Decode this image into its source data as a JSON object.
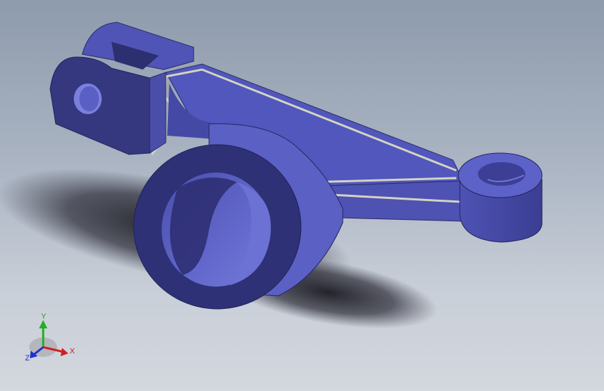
{
  "viewport": {
    "background_top": "#8e9bac",
    "background_bottom": "#d3d7de",
    "part_color": "#5a5fc0",
    "edge_color": "#c8c8b8"
  },
  "triad": {
    "x_label": "X",
    "y_label": "Y",
    "z_label": "Z",
    "x_color": "#d02020",
    "y_color": "#20b020",
    "z_color": "#2030d0"
  }
}
